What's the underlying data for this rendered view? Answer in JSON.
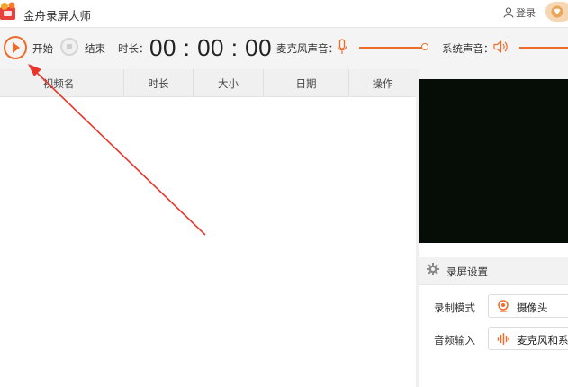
{
  "app": {
    "title": "金舟录屏大师",
    "login_label": "登录"
  },
  "toolbar": {
    "start_label": "开始",
    "stop_label": "结束",
    "duration_label": "时长：",
    "timer": "00 : 00 : 00",
    "mic_label": "麦克风声音：",
    "system_label": "系统声音："
  },
  "table": {
    "columns": [
      "视频名",
      "时长",
      "大小",
      "日期",
      "操作"
    ]
  },
  "settings": {
    "title": "录屏设置",
    "mode_label": "录制模式",
    "mode_value": "摄像头",
    "audio_label": "音频输入",
    "audio_value": "麦克风和系统"
  },
  "colors": {
    "accent": "#ef6b2a",
    "preview_bg": "#060d07"
  },
  "icons": [
    "app-logo-icon",
    "user-icon",
    "vip-diamond-icon",
    "play-icon",
    "stop-icon",
    "microphone-icon",
    "speaker-icon",
    "gear-icon",
    "webcam-icon",
    "audio-wave-icon"
  ]
}
